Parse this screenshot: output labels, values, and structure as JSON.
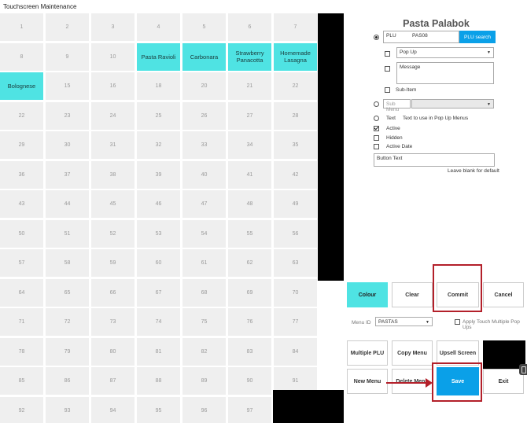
{
  "window": {
    "title": "Touchscreen Maintenance"
  },
  "grid": {
    "cells": [
      "1",
      "2",
      "3",
      "4",
      "5",
      "6",
      "7",
      "8",
      "9",
      "10",
      "Pasta Ravioli",
      "Carbonara",
      "Strawberry Panacotta",
      "Homemade Lasagna",
      "Bolognese",
      "15",
      "16",
      "18",
      "20",
      "21",
      "22",
      "22",
      "23",
      "24",
      "25",
      "26",
      "27",
      "28",
      "29",
      "30",
      "31",
      "32",
      "33",
      "34",
      "35",
      "36",
      "37",
      "38",
      "39",
      "40",
      "41",
      "42",
      "43",
      "44",
      "45",
      "46",
      "47",
      "48",
      "49",
      "50",
      "51",
      "52",
      "53",
      "54",
      "55",
      "56",
      "57",
      "58",
      "59",
      "60",
      "61",
      "62",
      "63",
      "64",
      "65",
      "66",
      "67",
      "68",
      "69",
      "70",
      "71",
      "72",
      "73",
      "74",
      "75",
      "76",
      "77",
      "78",
      "79",
      "80",
      "81",
      "82",
      "83",
      "84",
      "85",
      "86",
      "87",
      "88",
      "89",
      "90",
      "91",
      "92",
      "93",
      "94",
      "95",
      "96",
      "97",
      ""
    ],
    "active_labels": [
      "Pasta Ravioli",
      "Carbonara",
      "Strawberry Panacotta",
      "Homemade Lasagna",
      "Bolognese"
    ],
    "active_color": "#4fe3e3"
  },
  "panel": {
    "item_name": "Pasta Palabok",
    "plu": {
      "label": "PLU",
      "value": "PAS08",
      "search_button": "PLU search",
      "selected": true
    },
    "popup": {
      "value": "Pop Up",
      "checked": false
    },
    "message": {
      "placeholder": "Message",
      "checked": false
    },
    "sub_item": {
      "label": "Sub-Item",
      "checked": false
    },
    "sub_menu": {
      "placeholder": "Sub Menu",
      "selected": false
    },
    "text_option": {
      "label": "Text",
      "hint": "Text to use in Pop Up Menus",
      "selected": false
    },
    "active": {
      "label": "Active",
      "checked": true
    },
    "hidden": {
      "label": "Hidden",
      "checked": false
    },
    "active_date": {
      "label": "Active Date",
      "checked": false
    },
    "button_text": {
      "placeholder": "Button Text",
      "hint": "Leave blank for default"
    },
    "actions": {
      "colour": "Colour",
      "clear": "Clear",
      "commit": "Commit",
      "cancel": "Cancel"
    },
    "menu_id": {
      "label": "Menu ID",
      "value": "PASTAS"
    },
    "apply_touch": {
      "label": "Apply Touch Multiple Pop Ups",
      "checked": false
    },
    "bottom_buttons": {
      "multiple_plu": "Multiple PLU",
      "copy_menu": "Copy Menu",
      "upsell_screen": "Upsell Screen",
      "new_menu": "New Menu",
      "delete_menu": "Delete Menu",
      "save": "Save",
      "exit": "Exit"
    },
    "colors": {
      "accent_teal": "#4fe3e3",
      "accent_blue": "#0aa0e8",
      "highlight_red": "#b3202a"
    }
  }
}
